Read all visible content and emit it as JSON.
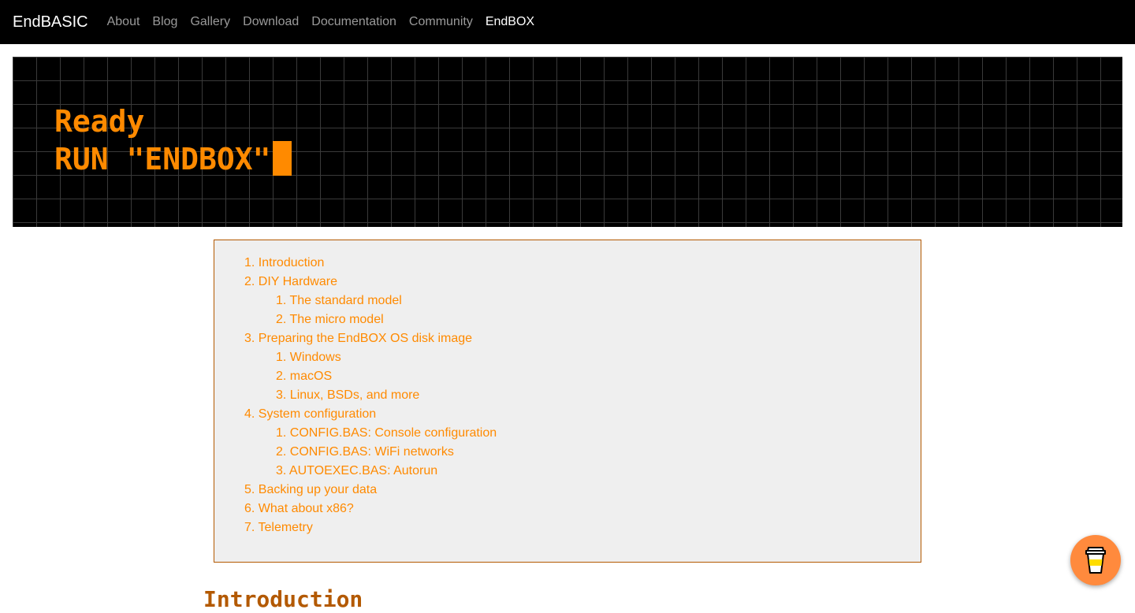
{
  "navbar": {
    "brand": "EndBASIC",
    "links": [
      {
        "label": "About"
      },
      {
        "label": "Blog"
      },
      {
        "label": "Gallery"
      },
      {
        "label": "Download"
      },
      {
        "label": "Documentation"
      },
      {
        "label": "Community"
      },
      {
        "label": "EndBOX"
      }
    ],
    "active_link": "EndBOX"
  },
  "hero": {
    "line1": "Ready",
    "line2": "RUN \"ENDBOX\"",
    "text_color": "#ff8a00",
    "background_color": "#000000"
  },
  "toc": {
    "items": [
      {
        "number": "1.",
        "label": "Introduction"
      },
      {
        "number": "2.",
        "label": "DIY Hardware",
        "children": [
          {
            "number": "1.",
            "label": "The standard model"
          },
          {
            "number": "2.",
            "label": "The micro model"
          }
        ]
      },
      {
        "number": "3.",
        "label": "Preparing the EndBOX OS disk image",
        "children": [
          {
            "number": "1.",
            "label": "Windows"
          },
          {
            "number": "2.",
            "label": "macOS"
          },
          {
            "number": "3.",
            "label": "Linux, BSDs, and more"
          }
        ]
      },
      {
        "number": "4.",
        "label": "System configuration",
        "children": [
          {
            "number": "1.",
            "label": "CONFIG.BAS: Console configuration"
          },
          {
            "number": "2.",
            "label": "CONFIG.BAS: WiFi networks"
          },
          {
            "number": "3.",
            "label": "AUTOEXEC.BAS: Autorun"
          }
        ]
      },
      {
        "number": "5.",
        "label": "Backing up your data"
      },
      {
        "number": "6.",
        "label": "What about x86?"
      },
      {
        "number": "7.",
        "label": "Telemetry"
      }
    ],
    "link_color": "#ff8a00",
    "border_color": "#b35900",
    "background_color": "#efefef"
  },
  "content": {
    "section_heading": "Introduction"
  },
  "floating_button": {
    "icon": "coffee-cup-icon",
    "color": "#ff8a3d"
  }
}
